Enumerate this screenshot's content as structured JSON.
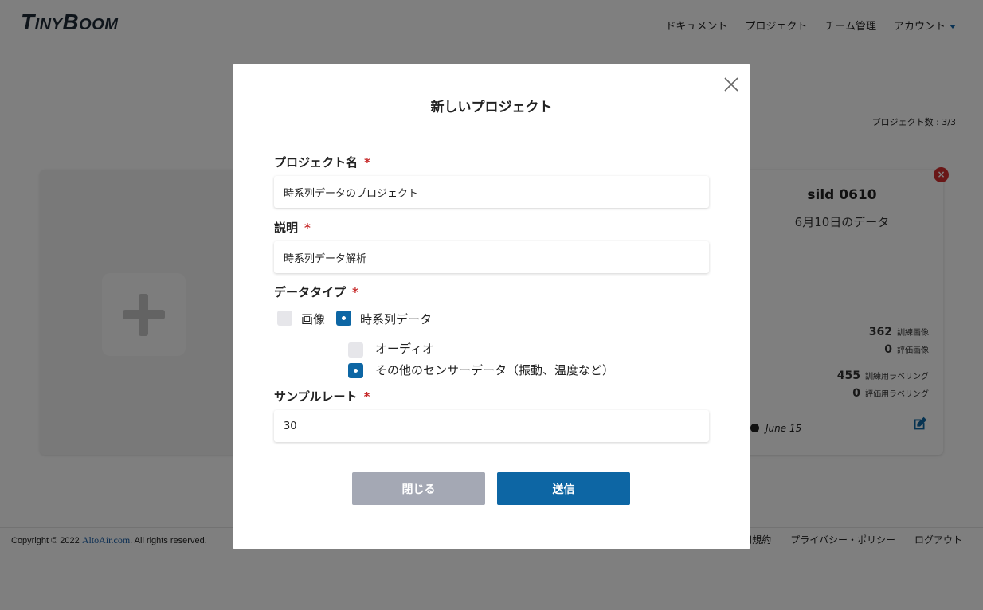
{
  "header": {
    "logo": "TinyBoom",
    "nav": [
      "ドキュメント",
      "プロジェクト",
      "チーム管理",
      "アカウント"
    ]
  },
  "main": {
    "project_count": "プロジェクト数 : 3/3",
    "project_card": {
      "title": "sild 0610",
      "description": "6月10日のデータ",
      "stats": [
        {
          "value": "362",
          "label": "訓練画像"
        },
        {
          "value": "0",
          "label": "評価画像"
        },
        {
          "value": "455",
          "label": "訓練用ラベリング"
        },
        {
          "value": "0",
          "label": "評価用ラベリング"
        }
      ],
      "date": "June 15"
    }
  },
  "footer": {
    "copyright_prefix": "Copyright © 2022 ",
    "copyright_link": "AltoAir.com",
    "copyright_suffix": ". All rights reserved.",
    "links": [
      "利用規約",
      "プライバシー・ポリシー",
      "ログアウト"
    ]
  },
  "modal": {
    "title": "新しいプロジェクト",
    "required_mark": "*",
    "fields": {
      "name": {
        "label": "プロジェクト名",
        "value": "時系列データのプロジェクト"
      },
      "description": {
        "label": "説明",
        "value": "時系列データ解析"
      },
      "data_type": {
        "label": "データタイプ",
        "options": [
          {
            "label": "画像",
            "checked": false
          },
          {
            "label": "時系列データ",
            "checked": true
          }
        ],
        "sub_options": [
          {
            "label": "オーディオ",
            "checked": false
          },
          {
            "label": "その他のセンサーデータ（振動、温度など）",
            "checked": true
          }
        ]
      },
      "sample_rate": {
        "label": "サンプルレート",
        "value": "30"
      }
    },
    "buttons": {
      "close": "閉じる",
      "submit": "送信"
    }
  },
  "colors": {
    "accent": "#0d66a4",
    "close_button": "#a4a8b4",
    "required": "#c62828",
    "delete_badge": "#d32f2f"
  }
}
